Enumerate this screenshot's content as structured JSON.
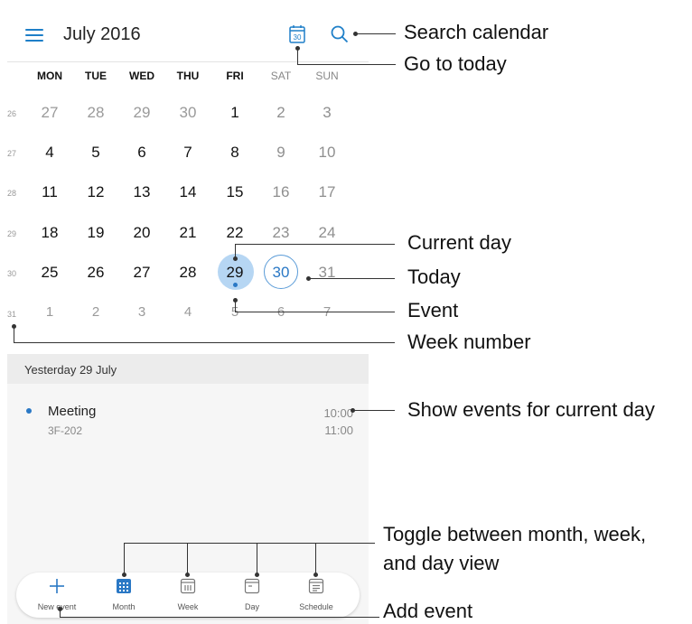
{
  "header": {
    "month_title": "July 2016",
    "menu_icon": "menu-icon",
    "today_icon_number": "30",
    "search_icon": "search-icon"
  },
  "weekdays": [
    "MON",
    "TUE",
    "WED",
    "THU",
    "FRI",
    "SAT",
    "SUN"
  ],
  "weeks": [
    {
      "number": "26",
      "days": [
        "27",
        "28",
        "29",
        "30",
        "1",
        "2",
        "3"
      ]
    },
    {
      "number": "27",
      "days": [
        "4",
        "5",
        "6",
        "7",
        "8",
        "9",
        "10"
      ]
    },
    {
      "number": "28",
      "days": [
        "11",
        "12",
        "13",
        "14",
        "15",
        "16",
        "17"
      ]
    },
    {
      "number": "29",
      "days": [
        "18",
        "19",
        "20",
        "21",
        "22",
        "23",
        "24"
      ]
    },
    {
      "number": "30",
      "days": [
        "25",
        "26",
        "27",
        "28",
        "29",
        "30",
        "31"
      ]
    },
    {
      "number": "31",
      "days": [
        "1",
        "2",
        "3",
        "4",
        "5",
        "6",
        "7"
      ]
    }
  ],
  "selected_day": "29",
  "today": "30",
  "events": {
    "header": "Yesterday  29 July",
    "items": [
      {
        "title": "Meeting",
        "location": "3F-202",
        "start": "10:00",
        "end": "11:00"
      }
    ]
  },
  "bottom_bar": {
    "tabs": [
      {
        "label": "New event",
        "icon": "plus-icon"
      },
      {
        "label": "Month",
        "icon": "month-grid-icon"
      },
      {
        "label": "Week",
        "icon": "week-icon"
      },
      {
        "label": "Day",
        "icon": "day-icon"
      },
      {
        "label": "Schedule",
        "icon": "schedule-icon"
      }
    ]
  },
  "annotations": {
    "search_calendar": "Search calendar",
    "go_to_today": "Go to today",
    "current_day": "Current day",
    "today": "Today",
    "event": "Event",
    "week_number": "Week number",
    "show_events": "Show events for current day",
    "toggle_views_line1": "Toggle between month, week,",
    "toggle_views_line2": "and day view",
    "add_event": "Add event"
  },
  "colors": {
    "accent": "#1e7fc8",
    "selected_fill": "#b6d6f3",
    "today_ring": "#5b9cd8"
  }
}
